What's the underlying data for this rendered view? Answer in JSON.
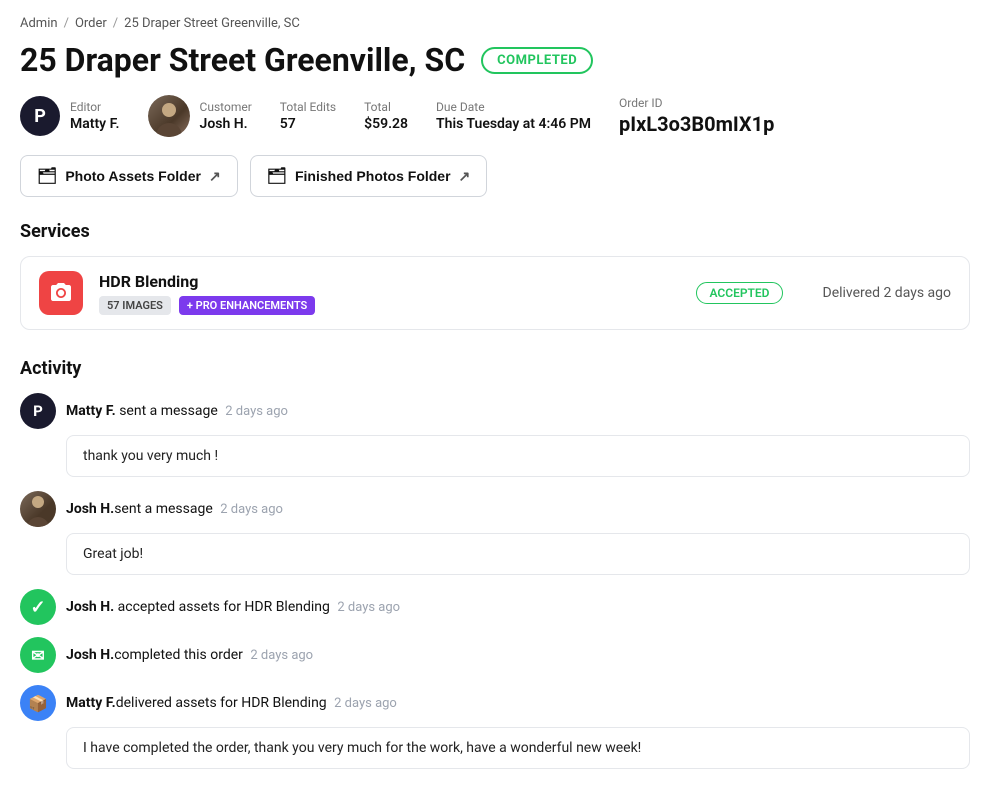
{
  "breadcrumb": {
    "items": [
      "Admin",
      "Order",
      "25 Draper Street  Greenville, SC"
    ]
  },
  "page": {
    "title": "25 Draper Street  Greenville, SC",
    "status_badge": "COMPLETED"
  },
  "order_meta": {
    "editor_label": "Editor",
    "editor_name": "Matty F.",
    "customer_label": "Customer",
    "customer_name": "Josh H.",
    "total_edits_label": "Total Edits",
    "total_edits_value": "57",
    "total_label": "Total",
    "total_value": "$59.28",
    "due_date_label": "Due Date",
    "due_date_value": "This Tuesday at 4:46 PM",
    "order_id_label": "Order ID",
    "order_id_value": "pIxL3o3B0mIX1p"
  },
  "folders": {
    "photo_assets_label": "Photo Assets Folder",
    "finished_photos_label": "Finished Photos Folder"
  },
  "services": {
    "section_title": "Services",
    "items": [
      {
        "name": "HDR Blending",
        "tag_images": "57 IMAGES",
        "tag_pro": "+ PRO ENHANCEMENTS",
        "status": "ACCEPTED",
        "delivered": "Delivered 2 days ago"
      }
    ]
  },
  "activity": {
    "section_title": "Activity",
    "items": [
      {
        "type": "message",
        "avatar_type": "editor",
        "sender": "Matty F.",
        "action": " sent a message",
        "time": "2 days ago",
        "message": "thank you very much !"
      },
      {
        "type": "message",
        "avatar_type": "customer",
        "sender": "Josh H.",
        "action": "sent a message",
        "time": "2 days ago",
        "message": "Great job!"
      },
      {
        "type": "accepted",
        "avatar_type": "green-check",
        "sender": "Josh H.",
        "action": " accepted assets for HDR Blending",
        "time": "2 days ago"
      },
      {
        "type": "completed",
        "avatar_type": "green-message",
        "sender": "Josh H.",
        "action": "completed this order",
        "time": "2 days ago"
      },
      {
        "type": "delivered",
        "avatar_type": "blue-box",
        "sender": "Matty F.",
        "action": "delivered assets for HDR Blending",
        "time": "2 days ago",
        "message": "I have completed the order, thank you very much for the work, have a wonderful new week!"
      }
    ]
  }
}
